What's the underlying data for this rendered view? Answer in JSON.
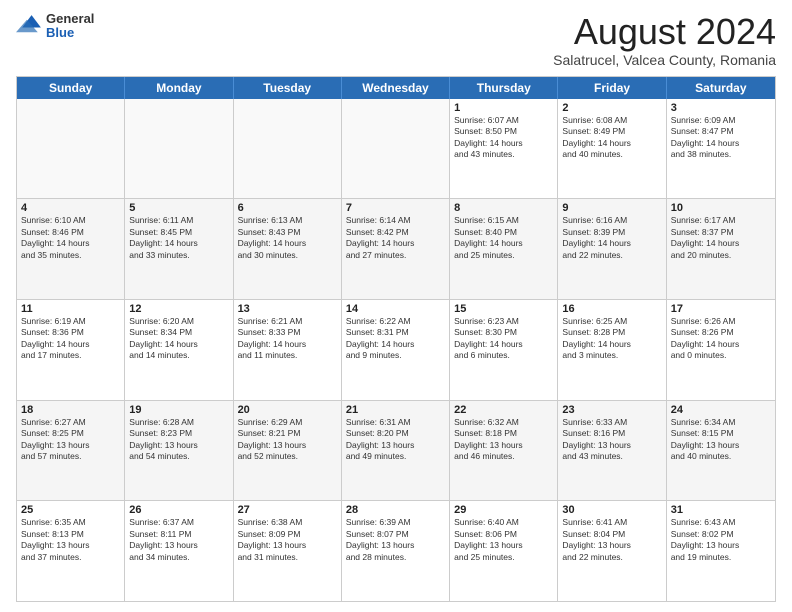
{
  "header": {
    "logo": {
      "line1": "General",
      "line2": "Blue"
    },
    "title": "August 2024",
    "subtitle": "Salatrucel, Valcea County, Romania"
  },
  "calendar": {
    "days_of_week": [
      "Sunday",
      "Monday",
      "Tuesday",
      "Wednesday",
      "Thursday",
      "Friday",
      "Saturday"
    ],
    "weeks": [
      [
        {
          "day": "",
          "info": ""
        },
        {
          "day": "",
          "info": ""
        },
        {
          "day": "",
          "info": ""
        },
        {
          "day": "",
          "info": ""
        },
        {
          "day": "1",
          "info": "Sunrise: 6:07 AM\nSunset: 8:50 PM\nDaylight: 14 hours\nand 43 minutes."
        },
        {
          "day": "2",
          "info": "Sunrise: 6:08 AM\nSunset: 8:49 PM\nDaylight: 14 hours\nand 40 minutes."
        },
        {
          "day": "3",
          "info": "Sunrise: 6:09 AM\nSunset: 8:47 PM\nDaylight: 14 hours\nand 38 minutes."
        }
      ],
      [
        {
          "day": "4",
          "info": "Sunrise: 6:10 AM\nSunset: 8:46 PM\nDaylight: 14 hours\nand 35 minutes."
        },
        {
          "day": "5",
          "info": "Sunrise: 6:11 AM\nSunset: 8:45 PM\nDaylight: 14 hours\nand 33 minutes."
        },
        {
          "day": "6",
          "info": "Sunrise: 6:13 AM\nSunset: 8:43 PM\nDaylight: 14 hours\nand 30 minutes."
        },
        {
          "day": "7",
          "info": "Sunrise: 6:14 AM\nSunset: 8:42 PM\nDaylight: 14 hours\nand 27 minutes."
        },
        {
          "day": "8",
          "info": "Sunrise: 6:15 AM\nSunset: 8:40 PM\nDaylight: 14 hours\nand 25 minutes."
        },
        {
          "day": "9",
          "info": "Sunrise: 6:16 AM\nSunset: 8:39 PM\nDaylight: 14 hours\nand 22 minutes."
        },
        {
          "day": "10",
          "info": "Sunrise: 6:17 AM\nSunset: 8:37 PM\nDaylight: 14 hours\nand 20 minutes."
        }
      ],
      [
        {
          "day": "11",
          "info": "Sunrise: 6:19 AM\nSunset: 8:36 PM\nDaylight: 14 hours\nand 17 minutes."
        },
        {
          "day": "12",
          "info": "Sunrise: 6:20 AM\nSunset: 8:34 PM\nDaylight: 14 hours\nand 14 minutes."
        },
        {
          "day": "13",
          "info": "Sunrise: 6:21 AM\nSunset: 8:33 PM\nDaylight: 14 hours\nand 11 minutes."
        },
        {
          "day": "14",
          "info": "Sunrise: 6:22 AM\nSunset: 8:31 PM\nDaylight: 14 hours\nand 9 minutes."
        },
        {
          "day": "15",
          "info": "Sunrise: 6:23 AM\nSunset: 8:30 PM\nDaylight: 14 hours\nand 6 minutes."
        },
        {
          "day": "16",
          "info": "Sunrise: 6:25 AM\nSunset: 8:28 PM\nDaylight: 14 hours\nand 3 minutes."
        },
        {
          "day": "17",
          "info": "Sunrise: 6:26 AM\nSunset: 8:26 PM\nDaylight: 14 hours\nand 0 minutes."
        }
      ],
      [
        {
          "day": "18",
          "info": "Sunrise: 6:27 AM\nSunset: 8:25 PM\nDaylight: 13 hours\nand 57 minutes."
        },
        {
          "day": "19",
          "info": "Sunrise: 6:28 AM\nSunset: 8:23 PM\nDaylight: 13 hours\nand 54 minutes."
        },
        {
          "day": "20",
          "info": "Sunrise: 6:29 AM\nSunset: 8:21 PM\nDaylight: 13 hours\nand 52 minutes."
        },
        {
          "day": "21",
          "info": "Sunrise: 6:31 AM\nSunset: 8:20 PM\nDaylight: 13 hours\nand 49 minutes."
        },
        {
          "day": "22",
          "info": "Sunrise: 6:32 AM\nSunset: 8:18 PM\nDaylight: 13 hours\nand 46 minutes."
        },
        {
          "day": "23",
          "info": "Sunrise: 6:33 AM\nSunset: 8:16 PM\nDaylight: 13 hours\nand 43 minutes."
        },
        {
          "day": "24",
          "info": "Sunrise: 6:34 AM\nSunset: 8:15 PM\nDaylight: 13 hours\nand 40 minutes."
        }
      ],
      [
        {
          "day": "25",
          "info": "Sunrise: 6:35 AM\nSunset: 8:13 PM\nDaylight: 13 hours\nand 37 minutes."
        },
        {
          "day": "26",
          "info": "Sunrise: 6:37 AM\nSunset: 8:11 PM\nDaylight: 13 hours\nand 34 minutes."
        },
        {
          "day": "27",
          "info": "Sunrise: 6:38 AM\nSunset: 8:09 PM\nDaylight: 13 hours\nand 31 minutes."
        },
        {
          "day": "28",
          "info": "Sunrise: 6:39 AM\nSunset: 8:07 PM\nDaylight: 13 hours\nand 28 minutes."
        },
        {
          "day": "29",
          "info": "Sunrise: 6:40 AM\nSunset: 8:06 PM\nDaylight: 13 hours\nand 25 minutes."
        },
        {
          "day": "30",
          "info": "Sunrise: 6:41 AM\nSunset: 8:04 PM\nDaylight: 13 hours\nand 22 minutes."
        },
        {
          "day": "31",
          "info": "Sunrise: 6:43 AM\nSunset: 8:02 PM\nDaylight: 13 hours\nand 19 minutes."
        }
      ]
    ]
  }
}
